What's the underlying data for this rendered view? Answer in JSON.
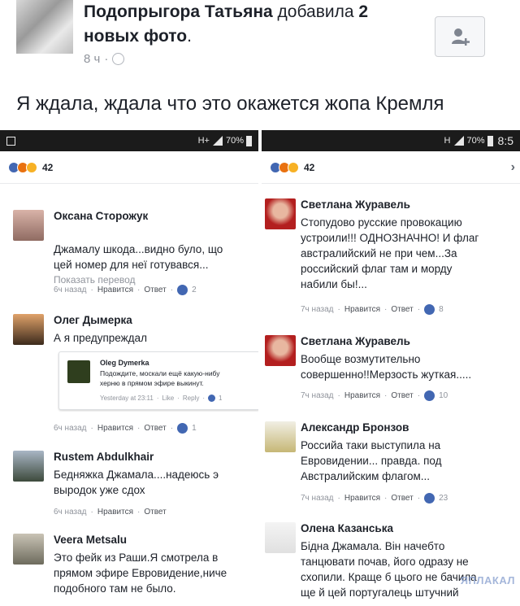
{
  "post": {
    "author": "Подопрыгора Татьяна",
    "action_prefix": "добавила",
    "count": "2",
    "action_suffix": "новых фото",
    "time": "8 ч",
    "text": "Я ждала, ждала что это окажется жопа Кремля"
  },
  "left_shot": {
    "status": {
      "network": "H+",
      "battery": "70%"
    },
    "reactions_count": "42",
    "comments": [
      {
        "name": "Оксана Сторожук",
        "text": "Джамалу шкода...видно було, що\nцей номер для неї готувався...",
        "translate": "Показать перевод",
        "time": "6ч назад",
        "like": "Нравится",
        "reply": "Ответ",
        "likes": "2"
      },
      {
        "name": "Олег Дымерка",
        "text": "А я предупреждал",
        "time": "6ч назад",
        "like": "Нравится",
        "reply": "Ответ",
        "likes": "1",
        "quote": {
          "name": "Oleg Dymerka",
          "text": "Подождите, москали ещё какую-нибу\nхерню в прямом эфире выкинут.",
          "time": "Yesterday at 23:11",
          "like": "Like",
          "reply": "Reply",
          "likes": "1"
        }
      },
      {
        "name": "Rustem Abdulkhair",
        "text": "Бедняжка Джамала....надеюсь э\nвыродок уже сдох",
        "time": "6ч назад",
        "like": "Нравится",
        "reply": "Ответ"
      },
      {
        "name": "Veera Metsalu",
        "text": "Это фейк из Раши.Я смотрела в\nпрямом эфире Евровидение,ниче\nподобного там не было."
      }
    ]
  },
  "right_shot": {
    "status": {
      "network": "H",
      "battery": "70%",
      "clock": "8:5"
    },
    "reactions_count": "42",
    "comments": [
      {
        "name": "Светлана Журавель",
        "text": "Стопудово русские провокацию\nустроили!!! ОДНОЗНАЧНО! И флаг\nавстралийский не при чем...За\nроссийский флаг там и морду\nнабили бы!...",
        "time": "7ч назад",
        "like": "Нравится",
        "reply": "Ответ",
        "likes": "8"
      },
      {
        "name": "Светлана Журавель",
        "text": "Вообще возмутительно\nсовершенно!!Мерзость жуткая.....",
        "time": "7ч назад",
        "like": "Нравится",
        "reply": "Ответ",
        "likes": "10"
      },
      {
        "name": "Александр Бронзов",
        "text": "Российа таки выступила на\nЕвровидении... правда. под\nАвстралийским флагом...",
        "time": "7ч назад",
        "like": "Нравится",
        "reply": "Ответ",
        "likes": "23"
      },
      {
        "name": "Олена Казанська",
        "text": "Бідна Джамала. Він начебто\nтанцювати почав, його одразу не\nсхопили. Краще б цього не бачила\nще й цей португалець штучний"
      }
    ]
  },
  "watermark": "ЯПЛАКАЛ",
  "colors": {
    "like_blue": "#4267b2",
    "meta_gray": "#90949c"
  }
}
